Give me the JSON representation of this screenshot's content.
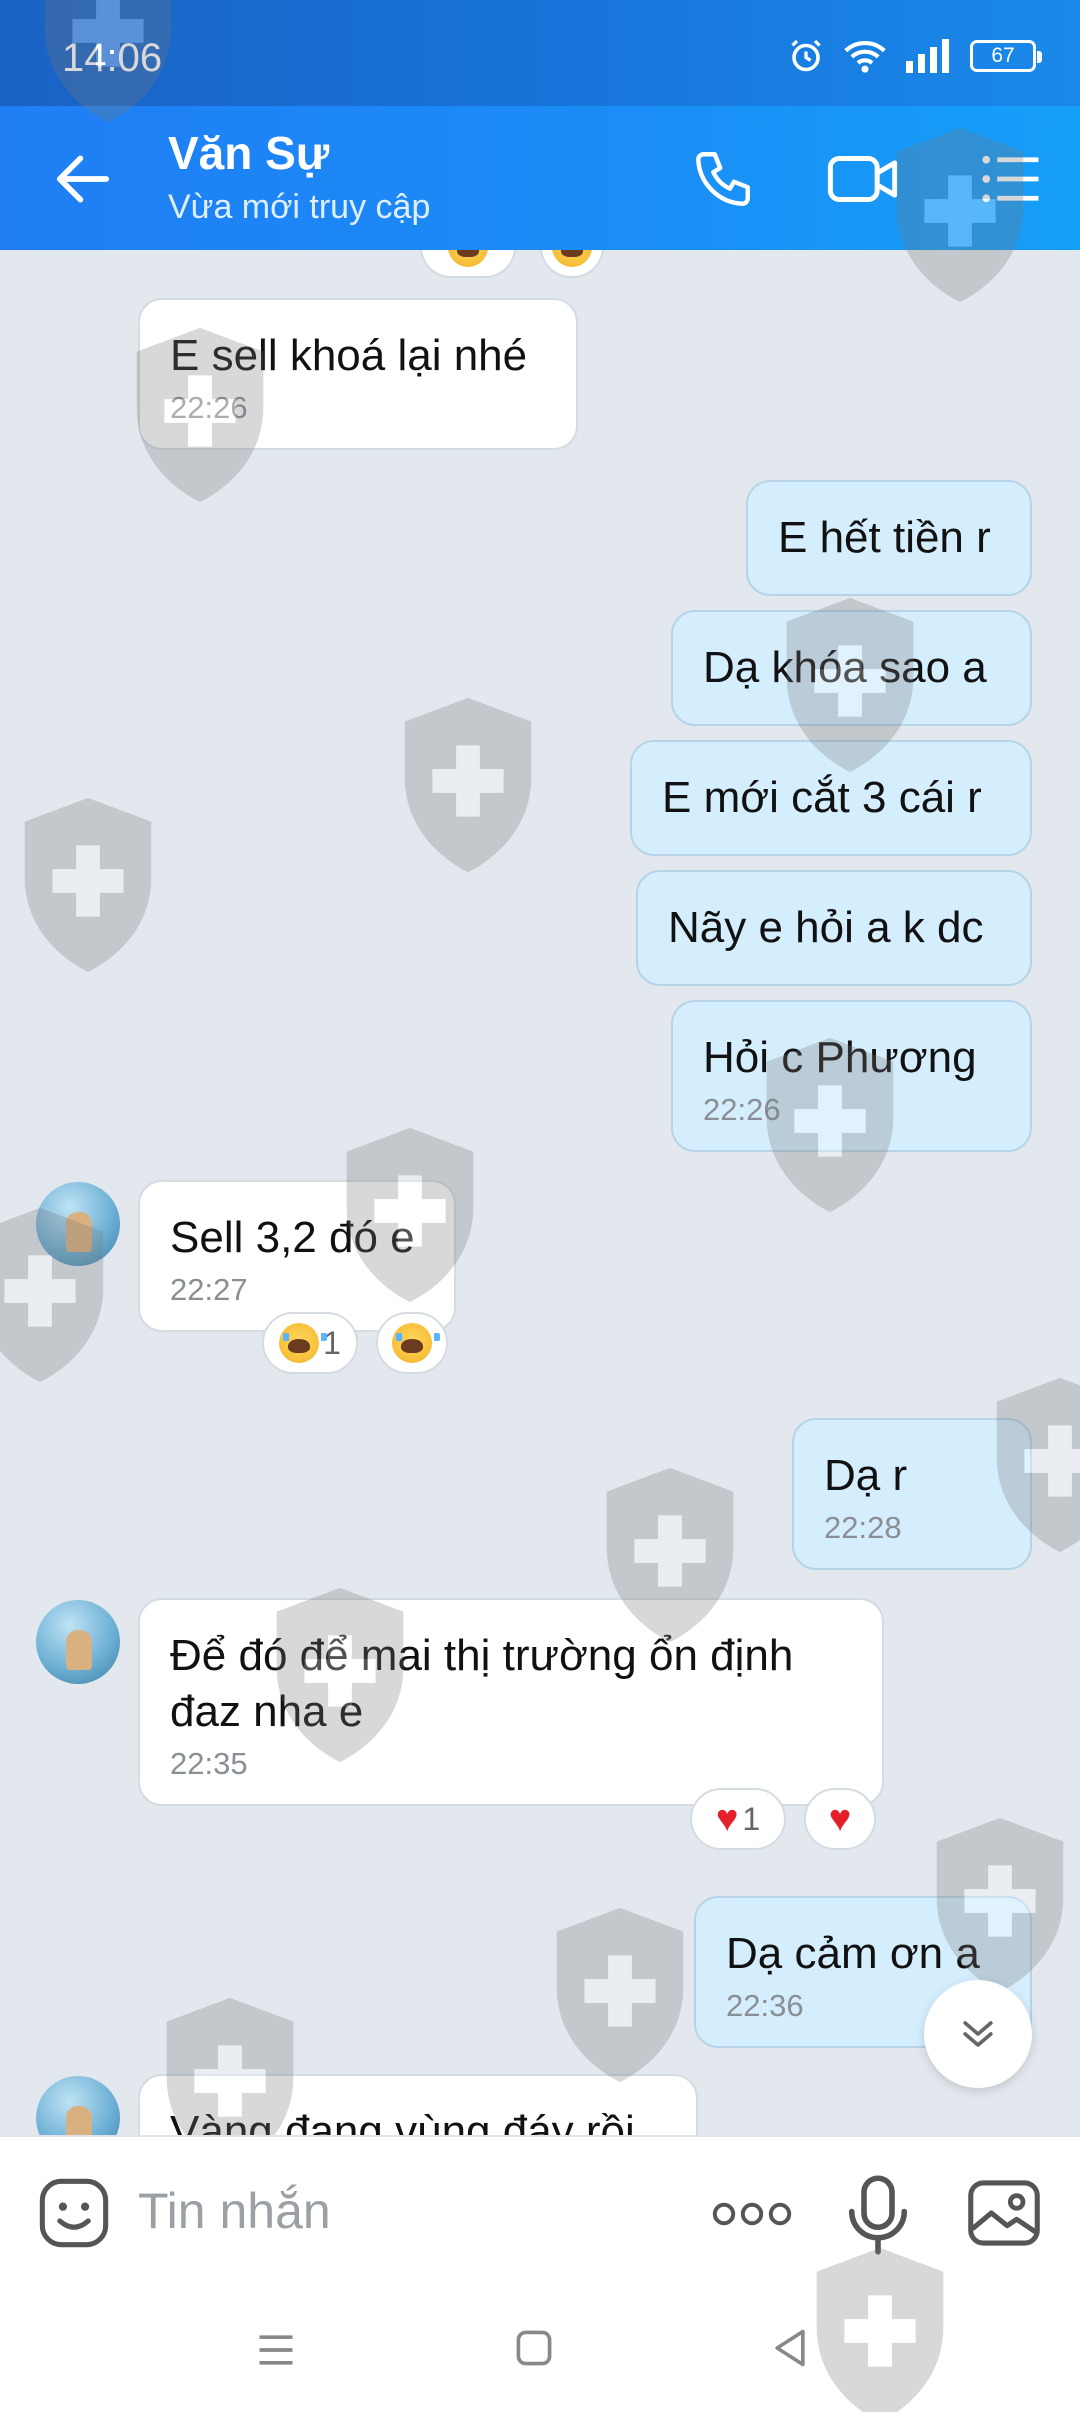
{
  "status": {
    "time": "14:06",
    "battery": "67"
  },
  "header": {
    "contact_name": "Văn Sự",
    "presence": "Vừa mới truy cập"
  },
  "messages": [
    {
      "dir": "in",
      "text": "E sell khoá lại nhé",
      "time": "22:26"
    },
    {
      "dir": "out",
      "text": "E hết tiền r"
    },
    {
      "dir": "out",
      "text": "Dạ khóa sao a"
    },
    {
      "dir": "out",
      "text": "E mới cắt 3 cái r"
    },
    {
      "dir": "out",
      "text": "Nãy e hỏi a k dc"
    },
    {
      "dir": "out",
      "text": "Hỏi c Phương",
      "time": "22:26"
    },
    {
      "dir": "in",
      "text": "Sell 3,2 đó e",
      "time": "22:27",
      "reaction_count": "1",
      "reaction": "crying-face"
    },
    {
      "dir": "out",
      "text": "Dạ r",
      "time": "22:28"
    },
    {
      "dir": "in",
      "text": "Để đó để mai thị trường ổn định đaz nha e",
      "time": "22:35",
      "reaction_count": "1",
      "reaction": "heart"
    },
    {
      "dir": "out",
      "text": "Dạ cảm ơn a",
      "time": "22:36"
    },
    {
      "dir": "in",
      "text": "Vàng đang vùng đáy rồi"
    }
  ],
  "composer": {
    "placeholder": "Tin nhắn"
  },
  "icons": {
    "back": "back-arrow-icon",
    "call": "phone-icon",
    "video": "video-call-icon",
    "menu": "list-menu-icon",
    "emoji": "sticker-icon",
    "more": "more-dots-icon",
    "mic": "microphone-icon",
    "gallery": "image-icon",
    "scroll": "chevron-double-down-icon"
  },
  "colors": {
    "header": "#1b8cf6",
    "bubble_out": "#d5eefe",
    "bubble_in": "#ffffff",
    "chat_bg": "#e2e8ee"
  }
}
